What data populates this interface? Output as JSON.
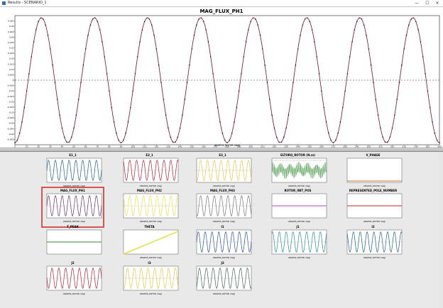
{
  "window": {
    "title": "Results - SCENARIO_1",
    "minimize_label": "—",
    "maximize_label": "☐",
    "close_label": "✕"
  },
  "main_chart": {
    "title": "MAG_FLUX_PH1",
    "xlabel": "ANGPOS_ROTOR (deg)",
    "xlim": [
      0,
      360
    ],
    "ylim": [
      -0.06,
      0.06
    ],
    "x_ticks": [
      "0",
      "10",
      "20",
      "30",
      "40",
      "50",
      "60",
      "70",
      "80",
      "90",
      "100",
      "110",
      "120",
      "130",
      "140",
      "150",
      "160",
      "170",
      "180",
      "190",
      "200",
      "210",
      "220",
      "230",
      "240",
      "250",
      "260",
      "270",
      "280",
      "290",
      "300",
      "310",
      "320",
      "330",
      "340",
      "350",
      "360"
    ],
    "y_ticks": [
      "0.055",
      "0.05",
      "0.045",
      "0.04",
      "0.035",
      "0.03",
      "0.025",
      "0.02",
      "0.015",
      "0.01",
      "0.005",
      "0",
      "-0.005",
      "-0.01",
      "-0.015",
      "-0.02",
      "-0.025",
      "-0.03",
      "-0.035",
      "-0.04",
      "-0.045",
      "-0.05",
      "-0.055"
    ]
  },
  "chart_data": {
    "type": "line",
    "title": "MAG_FLUX_PH1",
    "xlabel": "ANGPOS_ROTOR (deg)",
    "ylabel": "",
    "xlim": [
      0,
      360
    ],
    "ylim": [
      -0.06,
      0.06
    ],
    "series": [
      {
        "amplitude": 0.058,
        "cycles": 8,
        "phase_deg": -90,
        "color": "#7a2848",
        "markers": true
      }
    ],
    "zero_line": "dashed"
  },
  "thumbnails": [
    {
      "title": "E1_1",
      "color": "#1f5f8b",
      "kind": "sine",
      "phase": 0,
      "xlabel": "ANGPOS_ROTOR (deg)"
    },
    {
      "title": "E2_1",
      "color": "#b22234",
      "kind": "sine",
      "phase": 2.1,
      "xlabel": "ANGPOS_ROTOR (deg)"
    },
    {
      "title": "E3_1",
      "color": "#e5c84a",
      "kind": "sine",
      "phase": 4.2,
      "xlabel": "ANGPOS_ROTOR (deg)"
    },
    {
      "title": "ELTORQ_ROTOR (N.m)",
      "color": "#58a05a",
      "kind": "noise",
      "phase": 0,
      "xlabel": "ANGPOS_ROTOR (deg)"
    },
    {
      "title": "V_PHASE",
      "color": "#d07a20",
      "kind": "flatlow",
      "phase": 0,
      "xlabel": "ANGPOS_ROTOR (deg)"
    },
    {
      "title": "MAG_FLUX_PH1",
      "color": "#6a2e6a",
      "kind": "sine",
      "phase": 0,
      "xlabel": "ANGPOS_ROTOR (deg)",
      "selected": true
    },
    {
      "title": "MAG_FLUX_PH2",
      "color": "#e8e050",
      "kind": "sine",
      "phase": 2.1,
      "xlabel": "ANGPOS_ROTOR (deg)"
    },
    {
      "title": "MAG_FLUX_PH3",
      "color": "#777777",
      "kind": "sine",
      "phase": 4.2,
      "xlabel": "ANGPOS_ROTOR (deg)"
    },
    {
      "title": "ROTOR_INIT_POS",
      "color": "#c03cc0",
      "kind": "flatmid",
      "phase": 0,
      "xlabel": "ANGPOS_ROTOR (deg)"
    },
    {
      "title": "REPRESENTED_POLE_NUMBER",
      "color": "#d01c1c",
      "kind": "flatmid",
      "phase": 0,
      "xlabel": "ANGPOS_ROTOR (deg)"
    },
    {
      "title": "T_PEAK",
      "color": "#2f8f2f",
      "kind": "flatmid",
      "phase": 0,
      "xlabel": ""
    },
    {
      "title": "THETA",
      "color": "#e8e050",
      "kind": "ramp",
      "phase": 0,
      "xlabel": "ANGPOS_ROTOR (deg)"
    },
    {
      "title": "I1",
      "color": "#2a4f9f",
      "kind": "sine",
      "phase": 0,
      "xlabel": "ANGPOS_ROTOR (deg)"
    },
    {
      "title": "J1",
      "color": "#2a8f8f",
      "kind": "sine",
      "phase": 1.0,
      "xlabel": "ANGPOS_ROTOR (deg)"
    },
    {
      "title": "I2",
      "color": "#1f5f8b",
      "kind": "sine",
      "phase": 2.1,
      "xlabel": "ANGPOS_ROTOR (deg)"
    },
    {
      "title": "J2",
      "color": "#b22234",
      "kind": "sine",
      "phase": 3.1,
      "xlabel": "ANGPOS_ROTOR (deg)"
    },
    {
      "title": "I3",
      "color": "#e5c84a",
      "kind": "sine",
      "phase": 4.2,
      "xlabel": "ANGPOS_ROTOR (deg)"
    },
    {
      "title": "J3",
      "color": "#446655",
      "kind": "sine",
      "phase": 5.2,
      "xlabel": "ANGPOS_ROTOR (deg)"
    }
  ]
}
